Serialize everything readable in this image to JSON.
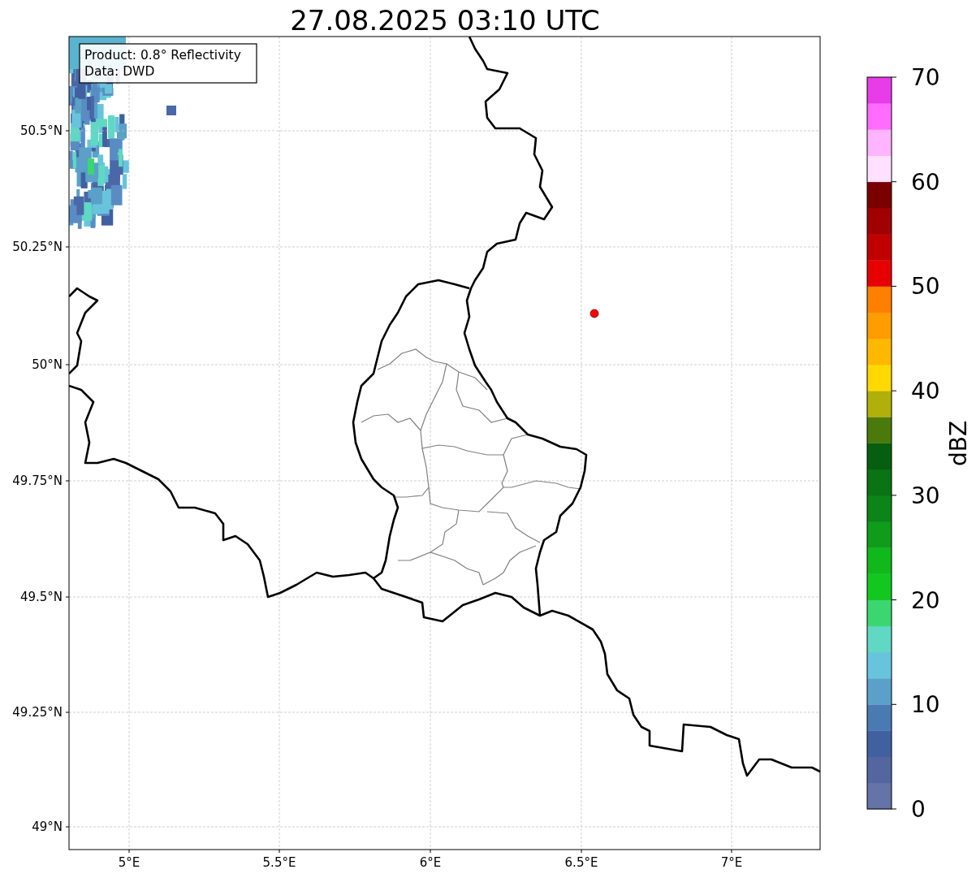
{
  "title": "27.08.2025 03:10 UTC",
  "info_box": {
    "lines": [
      "Product: 0.8° Reflectivity",
      "Data: DWD"
    ]
  },
  "map": {
    "lat_ticks": [
      "50.5°N",
      "50.25°N",
      "50°N",
      "49.75°N",
      "49.5°N",
      "49.25°N",
      "49°N"
    ],
    "lon_ticks": [
      "5°E",
      "5.5°E",
      "6°E",
      "6.5°E",
      "7°E"
    ]
  },
  "colorbar": {
    "label": "dBZ",
    "ticks": [
      "70",
      "60",
      "50",
      "40",
      "30",
      "20",
      "10",
      "0"
    ],
    "segments": [
      {
        "color": "#6474a8"
      },
      {
        "color": "#5366a0"
      },
      {
        "color": "#4160a0"
      },
      {
        "color": "#4a7ab2"
      },
      {
        "color": "#5aa0c8"
      },
      {
        "color": "#68c4dc"
      },
      {
        "color": "#60d8c4"
      },
      {
        "color": "#3cd670"
      },
      {
        "color": "#12c81e"
      },
      {
        "color": "#10b81c"
      },
      {
        "color": "#0e9c1a"
      },
      {
        "color": "#0c8418"
      },
      {
        "color": "#0a7414"
      },
      {
        "color": "#065e10"
      },
      {
        "color": "#4a7a0c"
      },
      {
        "color": "#b0b00a"
      },
      {
        "color": "#ffd800"
      },
      {
        "color": "#ffb800"
      },
      {
        "color": "#ff9c00"
      },
      {
        "color": "#ff8000"
      },
      {
        "color": "#e60000"
      },
      {
        "color": "#c00000"
      },
      {
        "color": "#a00000"
      },
      {
        "color": "#7a0000"
      },
      {
        "color": "#ffe0ff"
      },
      {
        "color": "#ffb4ff"
      },
      {
        "color": "#ff6cff"
      },
      {
        "color": "#e83ce8"
      }
    ]
  }
}
